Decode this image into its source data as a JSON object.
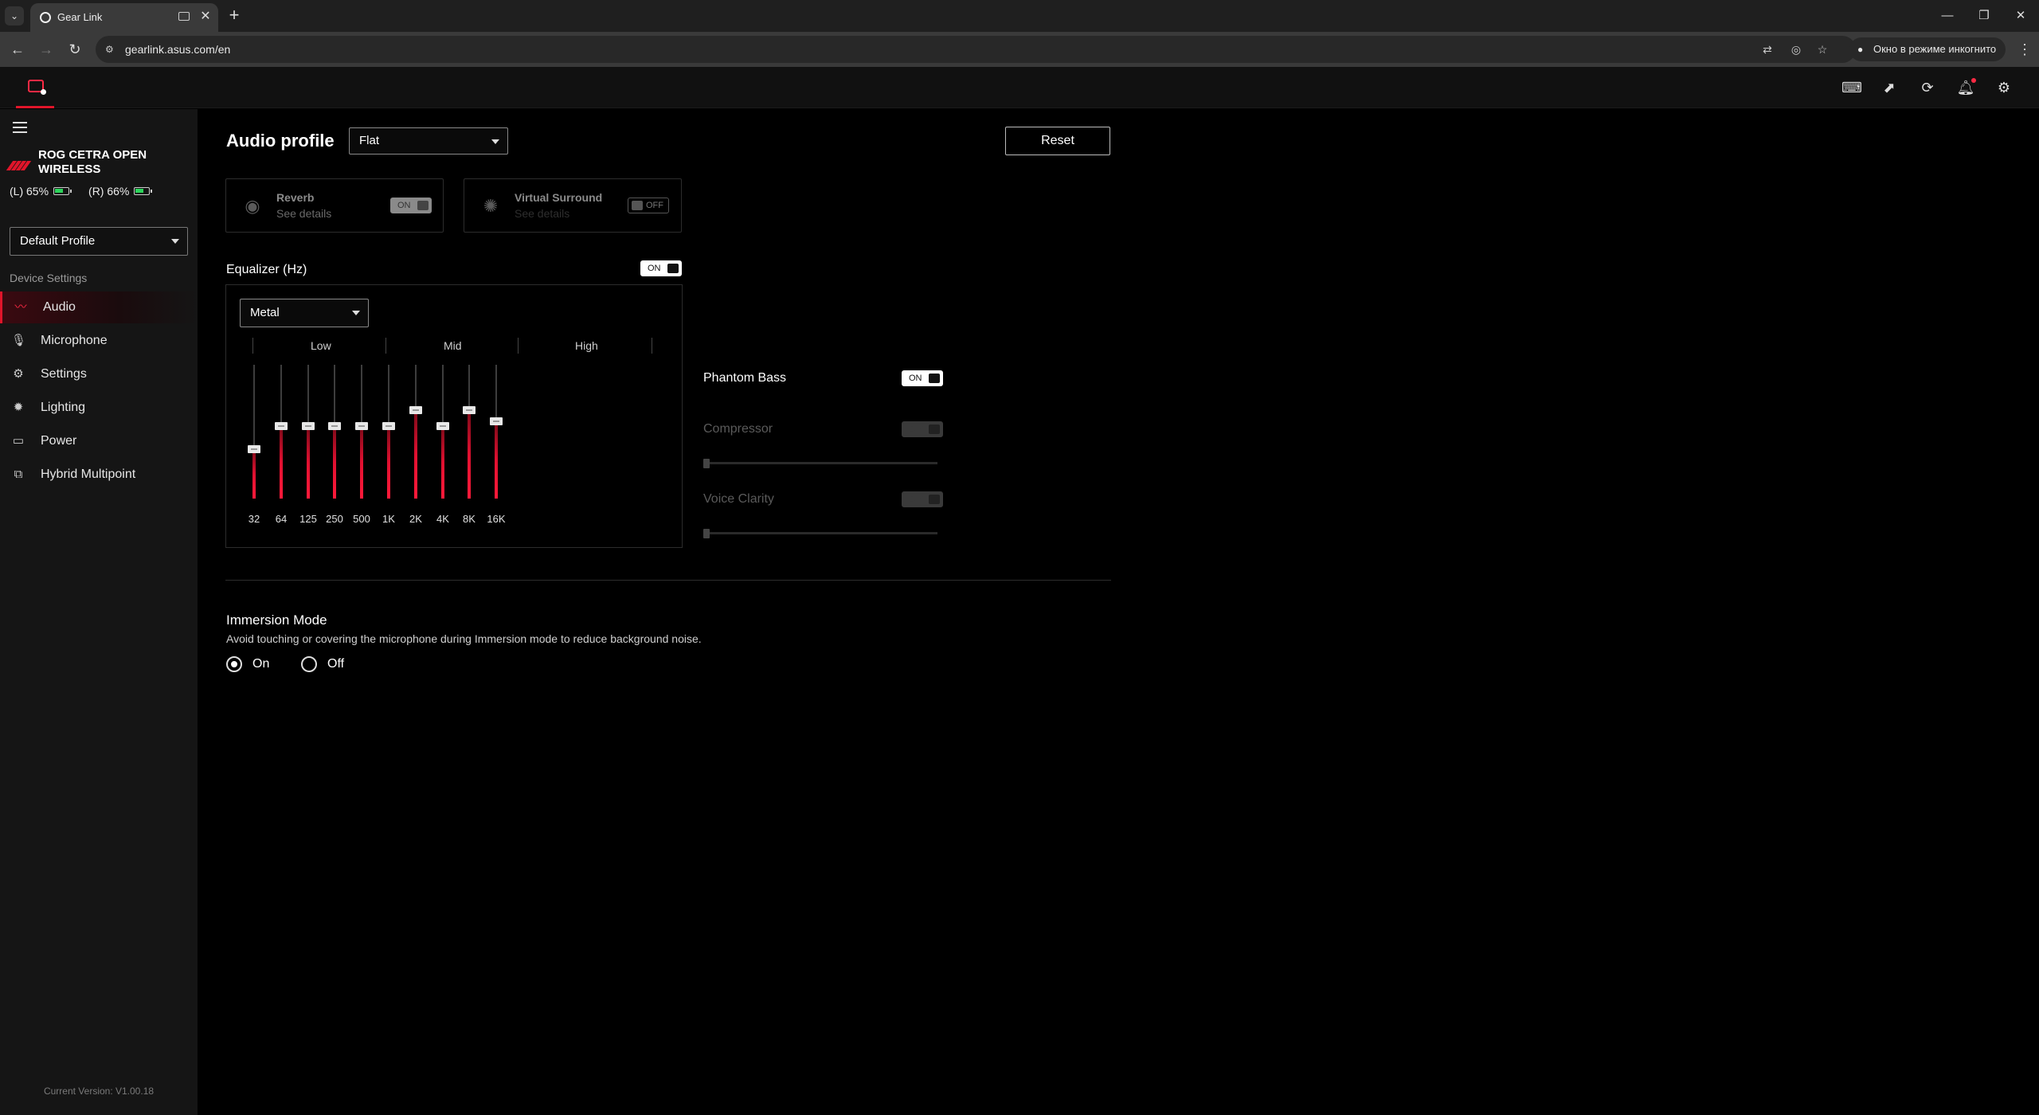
{
  "browser": {
    "tab_title": "Gear Link",
    "tab_close": "✕",
    "new_tab": "+",
    "url": "gearlink.asus.com/en",
    "incognito_label": "Окно в режиме инкогнито"
  },
  "sidebar": {
    "device_name": "ROG CETRA OPEN WIRELESS",
    "battery_left": "(L) 65%",
    "battery_right": "(R) 66%",
    "battery_left_level": 0.65,
    "battery_right_level": 0.66,
    "profile": "Default Profile",
    "section_label": "Device Settings",
    "items": [
      {
        "label": "Audio",
        "icon": "audio-waveform-icon",
        "active": true
      },
      {
        "label": "Microphone",
        "icon": "microphone-icon",
        "active": false
      },
      {
        "label": "Settings",
        "icon": "gear-icon",
        "active": false
      },
      {
        "label": "Lighting",
        "icon": "lighting-icon",
        "active": false
      },
      {
        "label": "Power",
        "icon": "battery-icon",
        "active": false
      },
      {
        "label": "Hybrid Multipoint",
        "icon": "multipoint-icon",
        "active": false
      }
    ],
    "version": "Current Version: V1.00.18"
  },
  "main": {
    "title": "Audio profile",
    "audio_profile": "Flat",
    "reset_label": "Reset",
    "reverb": {
      "name": "Reverb",
      "sub": "See details",
      "toggle": "ON"
    },
    "virtual_surround": {
      "name": "Virtual Surround",
      "sub": "See details",
      "toggle": "OFF"
    },
    "equalizer": {
      "label": "Equalizer (Hz)",
      "toggle": "ON",
      "preset": "Metal",
      "groups": [
        "Low",
        "Mid",
        "High"
      ],
      "bands": [
        {
          "freq": "32",
          "level": 0.37
        },
        {
          "freq": "64",
          "level": 0.54
        },
        {
          "freq": "125",
          "level": 0.54
        },
        {
          "freq": "250",
          "level": 0.54
        },
        {
          "freq": "500",
          "level": 0.54
        },
        {
          "freq": "1K",
          "level": 0.54
        },
        {
          "freq": "2K",
          "level": 0.66
        },
        {
          "freq": "4K",
          "level": 0.54
        },
        {
          "freq": "8K",
          "level": 0.66
        },
        {
          "freq": "16K",
          "level": 0.58
        }
      ]
    },
    "phantom_bass": {
      "label": "Phantom Bass",
      "toggle": "ON"
    },
    "compressor": {
      "label": "Compressor",
      "toggle": "OFF",
      "level": 0
    },
    "voice_clarity": {
      "label": "Voice Clarity",
      "toggle": "OFF",
      "level": 0
    },
    "immersion": {
      "title": "Immersion Mode",
      "desc": "Avoid touching or covering the microphone during Immersion mode to reduce background noise.",
      "on_label": "On",
      "off_label": "Off",
      "selected": "On"
    }
  },
  "colors": {
    "accent": "#e0152a",
    "battery": "#2bd45a"
  }
}
